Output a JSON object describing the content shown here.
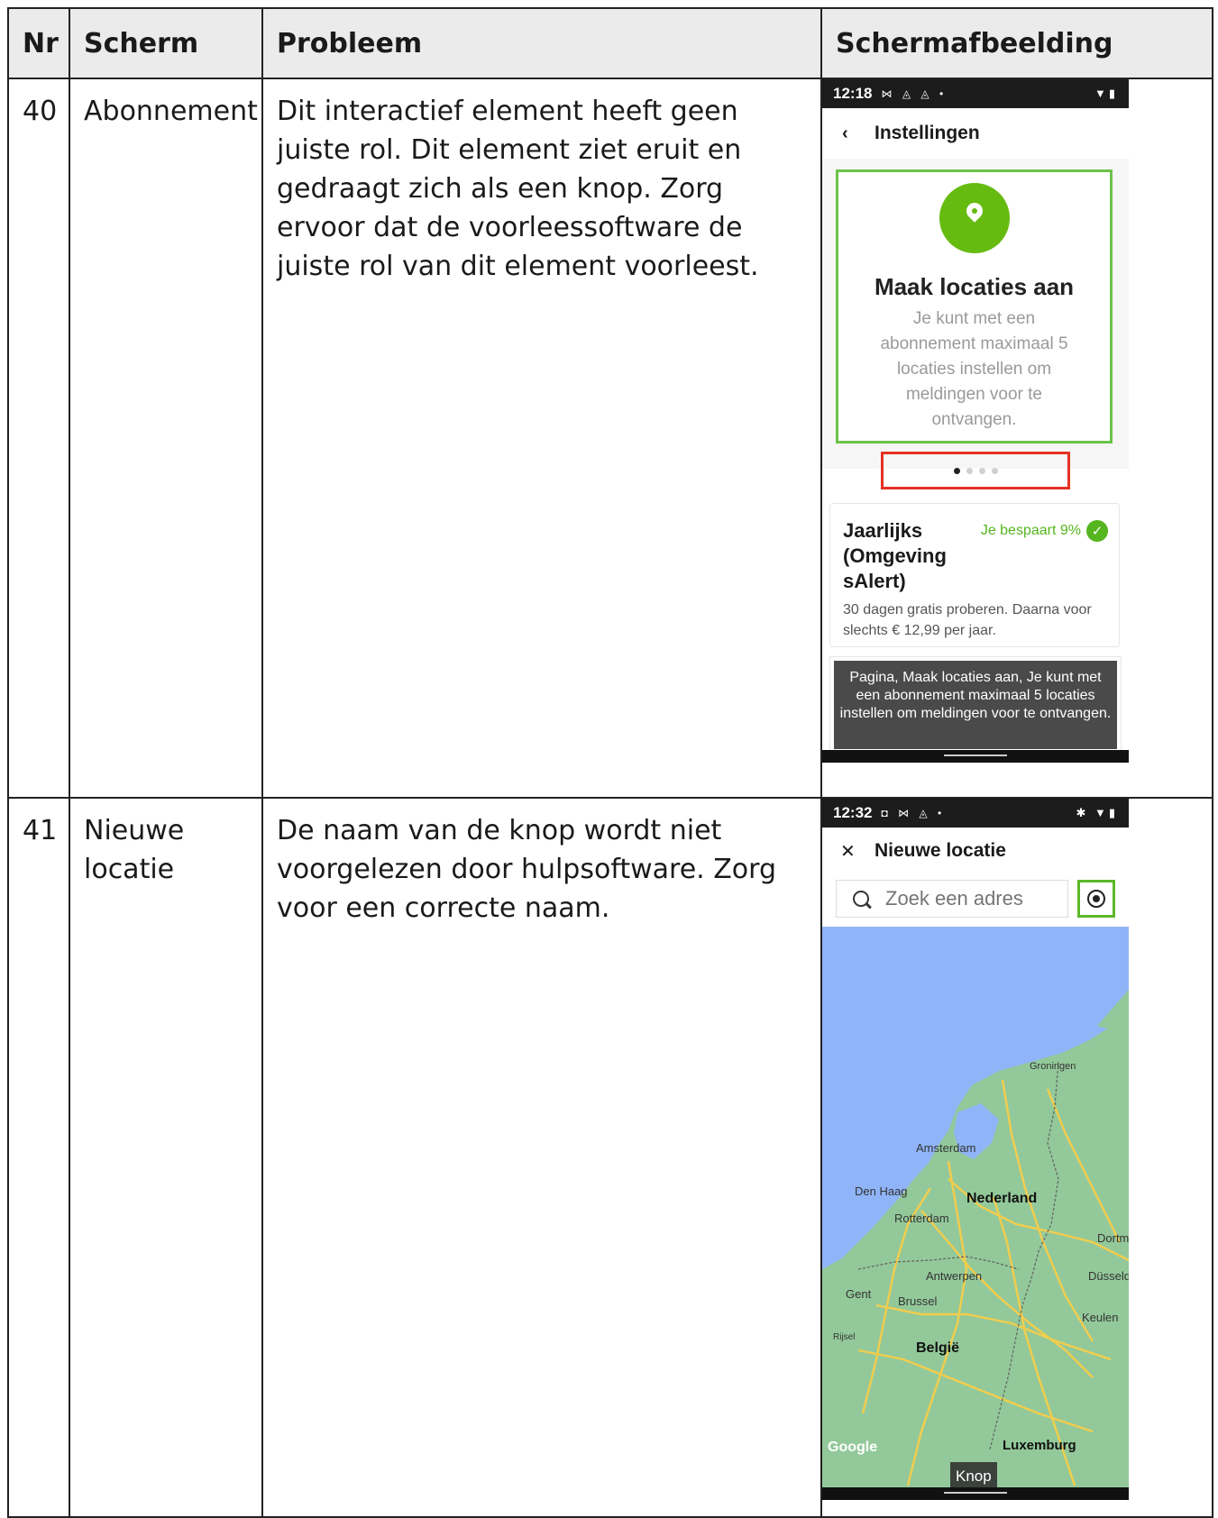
{
  "header": {
    "nr": "Nr",
    "scherm": "Scherm",
    "probleem": "Probleem",
    "schermafbeelding": "Schermafbeelding"
  },
  "rows": [
    {
      "nr": "40",
      "scherm": "Abonnement",
      "probleem": "Dit interactief element heeft geen juiste rol. Dit element ziet eruit en gedraagt zich als een knop. Zorg ervoor dat de voorleessoftware de juiste rol van dit element voorleest.",
      "phone": {
        "time": "12:18",
        "status_icons": "⋈ ◬ ◬ •",
        "status_right": "▼▮",
        "appbar_title": "Instellingen",
        "promo_title": "Maak locaties aan",
        "promo_text": "Je kunt met een abonnement maximaal 5 locaties instellen om meldingen voor te ontvangen.",
        "pager_dots": 4,
        "pager_active": 1,
        "plan_name": "Jaarlijks (Omgeving sAlert)",
        "plan_badge": "Je bespaart 9%",
        "plan_desc": "30 dagen gratis proberen. Daarna voor slechts € 12,99 per jaar.",
        "toast": "Pagina, Maak locaties aan, Je kunt met een abonnement maximaal 5 locaties instellen om meldingen voor te ontvangen.",
        "colors": {
          "focus_green": "#6cc24a",
          "highlight_red": "#e53224",
          "pin_green": "#66bb11"
        }
      }
    },
    {
      "nr": "41",
      "scherm": "Nieuwe locatie",
      "probleem": "De naam van de knop wordt niet voorgelezen door hulpsoftware. Zorg voor een correcte naam.",
      "phone": {
        "time": "12:32",
        "status_icons": "◘ ⋈ ◬ •",
        "status_right": "✱ ▼▮",
        "appbar_title": "Nieuwe locatie",
        "search_placeholder": "Zoek een adres",
        "map_labels": {
          "groningen": "Groningen",
          "amsterdam": "Amsterdam",
          "den_haag": "Den Haag",
          "nederland": "Nederland",
          "rotterdam": "Rotterdam",
          "dortmund": "Dortm",
          "antwerpen": "Antwerpen",
          "dusseldorf": "Düsseld",
          "gent": "Gent",
          "brussel": "Brussel",
          "keulen": "Keulen",
          "rijsel": "Rijsel",
          "belgie": "België",
          "luxemburg": "Luxemburg",
          "google": "Google"
        },
        "tooltip": "Knop",
        "colors": {
          "sea": "#8fb4f7",
          "land": "#93c99a",
          "road": "#f3cd4c",
          "focus_green": "#5cb82a"
        }
      }
    }
  ]
}
